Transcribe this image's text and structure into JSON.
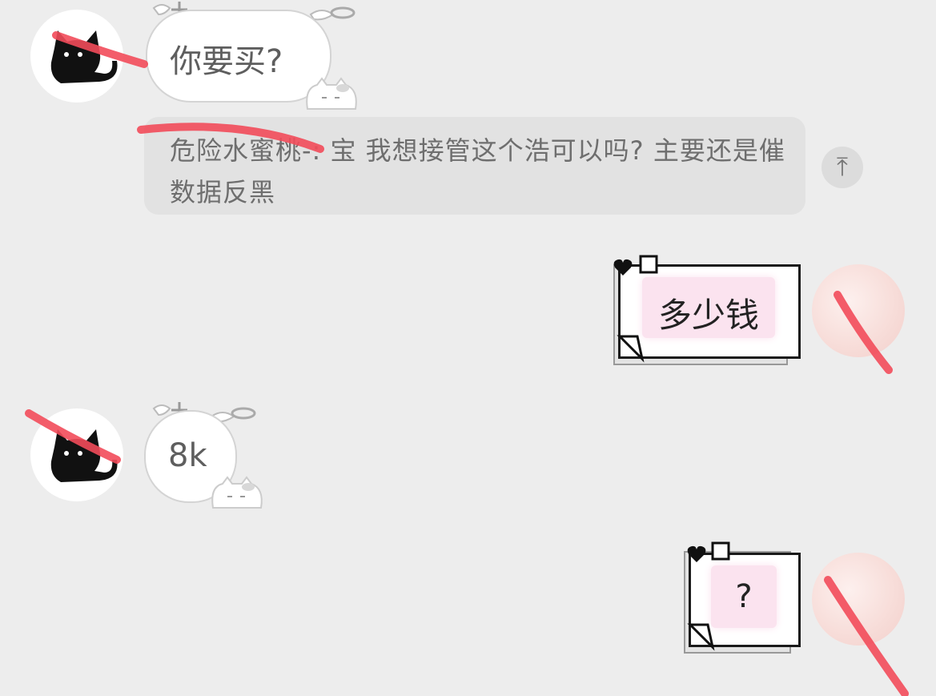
{
  "messages": {
    "m1": {
      "text": "你要买?"
    },
    "quote": {
      "text": "危险水蜜桃-: 宝 我想接管这个浩可以吗? 主要还是催数据反黑"
    },
    "m2": {
      "text": "多少钱"
    },
    "m3": {
      "text": "8k"
    },
    "m4": {
      "text": "?"
    }
  },
  "icons": {
    "quote_jump": "arrow-up-bar-icon",
    "cat_avatar": "black-cat-icon"
  },
  "colors": {
    "background": "#ededed",
    "quote_background": "#e2e2e2",
    "note_pink": "#fbe3ef",
    "redaction": "#f24b5a"
  }
}
